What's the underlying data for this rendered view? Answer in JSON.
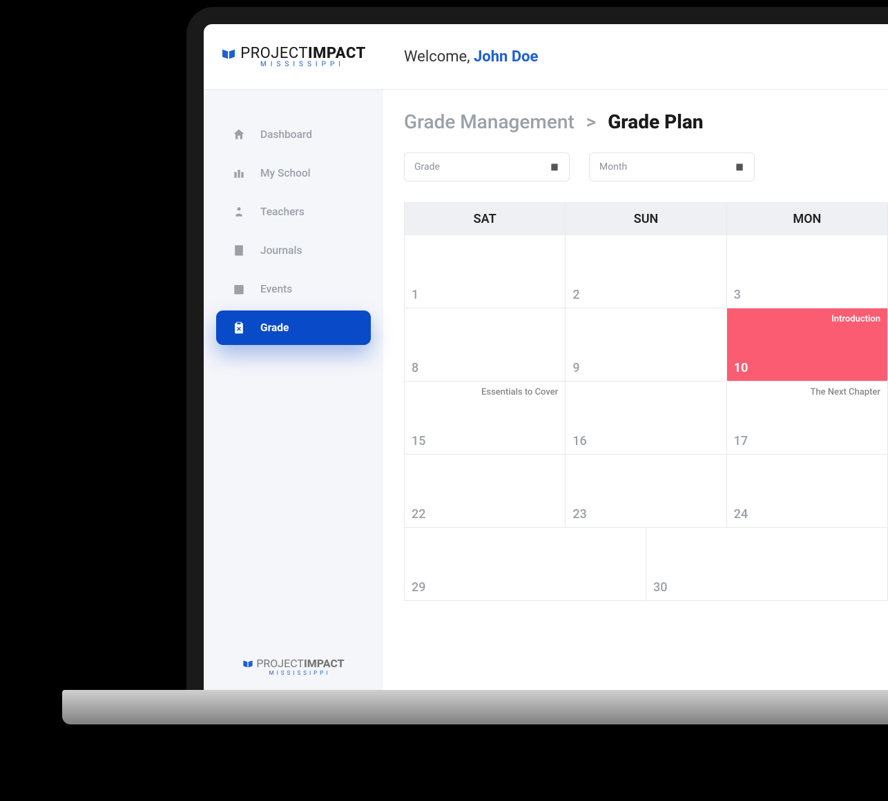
{
  "brand": {
    "name_part1": "PROJECT",
    "name_part2": "IMPACT",
    "subtitle": "MISSISSIPPI"
  },
  "header": {
    "welcome_prefix": "Welcome, ",
    "username": "John Doe"
  },
  "sidebar": {
    "items": [
      {
        "label": "Dashboard",
        "icon": "home-icon",
        "active": false
      },
      {
        "label": "My School",
        "icon": "school-icon",
        "active": false
      },
      {
        "label": "Teachers",
        "icon": "teacher-icon",
        "active": false
      },
      {
        "label": "Journals",
        "icon": "journal-icon",
        "active": false
      },
      {
        "label": "Events",
        "icon": "events-icon",
        "active": false
      },
      {
        "label": "Grade",
        "icon": "grade-icon",
        "active": true
      }
    ]
  },
  "breadcrumb": {
    "parent": "Grade Management",
    "separator": ">",
    "current": "Grade Plan"
  },
  "filters": {
    "grade_label": "Grade",
    "month_label": "Month"
  },
  "calendar": {
    "day_headers": [
      "SAT",
      "SUN",
      "MON"
    ],
    "weeks": [
      [
        {
          "day": "1",
          "event": "",
          "highlight": false
        },
        {
          "day": "2",
          "event": "",
          "highlight": false
        },
        {
          "day": "3",
          "event": "",
          "highlight": false
        }
      ],
      [
        {
          "day": "8",
          "event": "",
          "highlight": false
        },
        {
          "day": "9",
          "event": "",
          "highlight": false
        },
        {
          "day": "10",
          "event": "Introduction",
          "highlight": true
        }
      ],
      [
        {
          "day": "15",
          "event": "Essentials to Cover",
          "highlight": false
        },
        {
          "day": "16",
          "event": "",
          "highlight": false
        },
        {
          "day": "17",
          "event": "The Next Chapter",
          "highlight": false
        }
      ],
      [
        {
          "day": "22",
          "event": "",
          "highlight": false
        },
        {
          "day": "23",
          "event": "",
          "highlight": false
        },
        {
          "day": "24",
          "event": "",
          "highlight": false
        }
      ],
      [
        {
          "day": "29",
          "event": "",
          "highlight": false
        },
        {
          "day": "30",
          "event": "",
          "highlight": false
        }
      ]
    ]
  }
}
